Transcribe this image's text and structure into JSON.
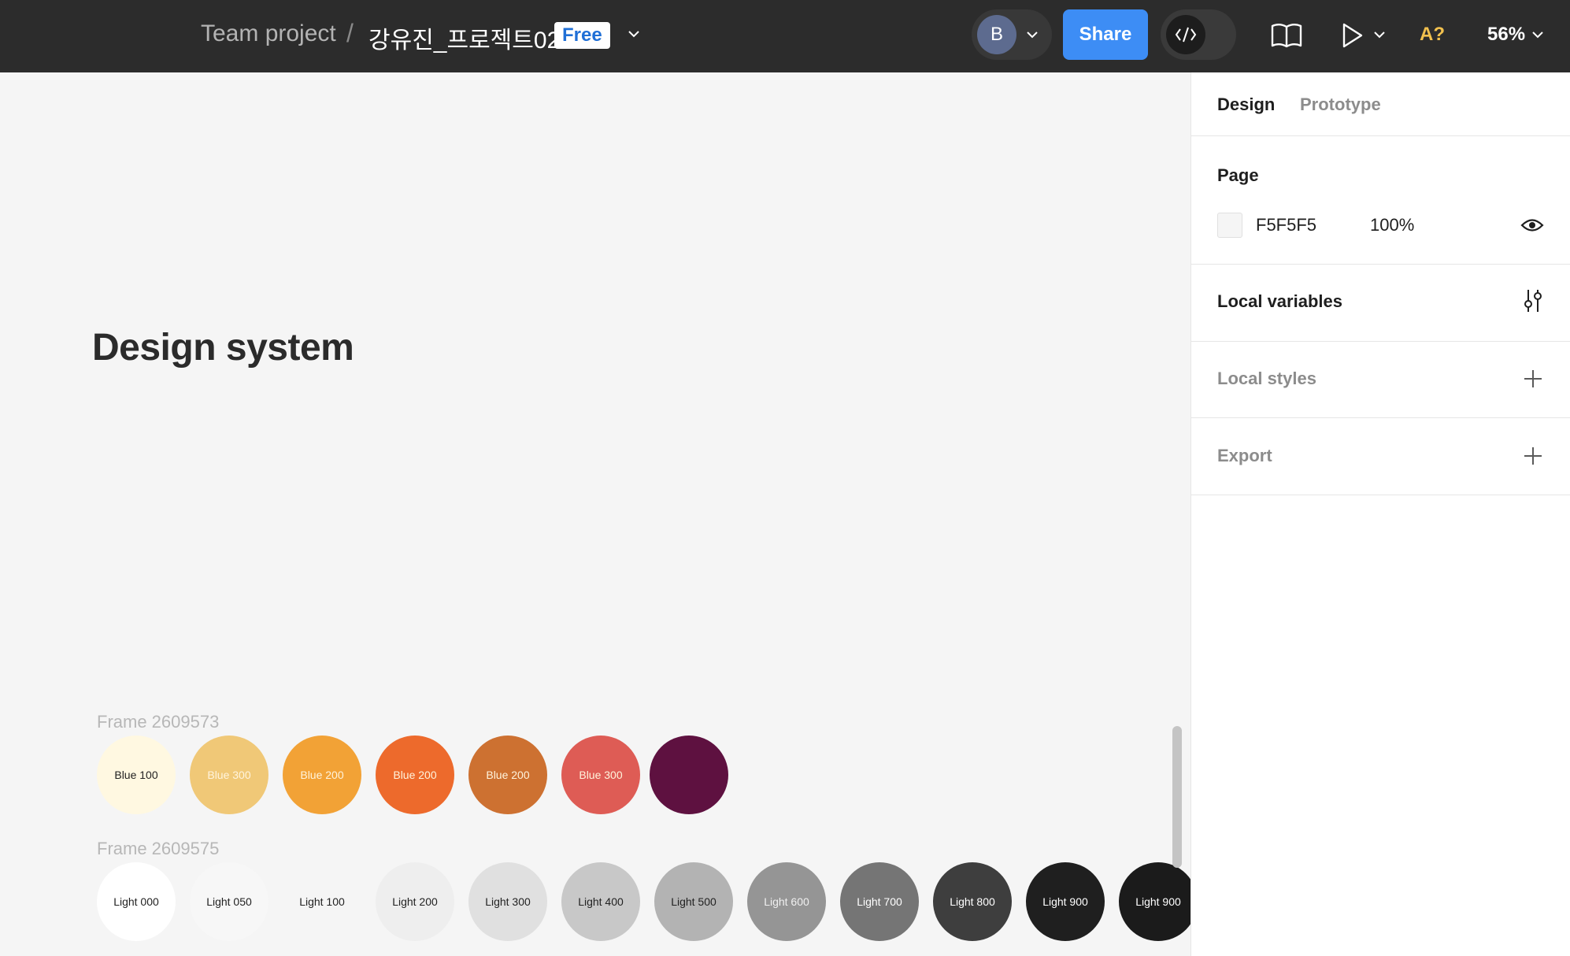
{
  "topbar": {
    "breadcrumb_team": "Team project",
    "breadcrumb_sep": "/",
    "file_name": "강유진_프로젝트02",
    "plan_badge": "Free",
    "avatar_initial": "B",
    "share_label": "Share",
    "a11y_label": "A?",
    "zoom": "56%",
    "accent_color": "#3d8df5"
  },
  "canvas": {
    "title": "Design system",
    "frames": [
      {
        "label": "Frame 2609573",
        "swatches": [
          {
            "label": "Blue 100",
            "color": "#fff8e1",
            "text_color": "#222222"
          },
          {
            "label": "Blue 300",
            "color": "#f0c877",
            "text_color": "#fff4dd"
          },
          {
            "label": "Blue 200",
            "color": "#f2a236",
            "text_color": "#fff4dd"
          },
          {
            "label": "Blue 200",
            "color": "#ed6a2c",
            "text_color": "#fff4dd"
          },
          {
            "label": "Blue 200",
            "color": "#cd7131",
            "text_color": "#fff4dd"
          },
          {
            "label": "Blue 300",
            "color": "#de5c55",
            "text_color": "#fff4dd"
          },
          {
            "label": "",
            "color": "#5e1140",
            "text_color": "#ffffff"
          }
        ]
      },
      {
        "label": "Frame 2609575",
        "swatches": [
          {
            "label": "Light 000",
            "color": "#ffffff",
            "text_color": "#222222"
          },
          {
            "label": "Light 050",
            "color": "#f7f7f7",
            "text_color": "#222222"
          },
          {
            "label": "Light 100",
            "color": "#f5f5f5",
            "text_color": "#222222"
          },
          {
            "label": "Light 200",
            "color": "#eeeeee",
            "text_color": "#222222"
          },
          {
            "label": "Light 300",
            "color": "#e0e0e0",
            "text_color": "#222222"
          },
          {
            "label": "Light 400",
            "color": "#c8c8c8",
            "text_color": "#222222"
          },
          {
            "label": "Light 500",
            "color": "#b3b3b3",
            "text_color": "#222222"
          },
          {
            "label": "Light 600",
            "color": "#959595",
            "text_color": "#f0f0f0"
          },
          {
            "label": "Light 700",
            "color": "#757575",
            "text_color": "#ffffff"
          },
          {
            "label": "Light 800",
            "color": "#3e3e3e",
            "text_color": "#ffffff"
          },
          {
            "label": "Light 900",
            "color": "#1f1f1f",
            "text_color": "#ffffff"
          },
          {
            "label": "Light 900",
            "color": "#1b1b1b",
            "text_color": "#ffffff"
          }
        ]
      }
    ]
  },
  "panel": {
    "tabs": [
      {
        "label": "Design",
        "active": true
      },
      {
        "label": "Prototype",
        "active": false
      }
    ],
    "page": {
      "title": "Page",
      "background_hex": "F5F5F5",
      "opacity": "100%"
    },
    "local_variables": "Local variables",
    "local_styles": "Local styles",
    "export": "Export"
  },
  "icons": {
    "chevron": "chevron-down-icon",
    "dev_mode": "code-icon",
    "library": "book-icon",
    "present": "play-icon",
    "visibility": "eye-icon",
    "variables": "sliders-icon",
    "add": "plus-icon"
  }
}
